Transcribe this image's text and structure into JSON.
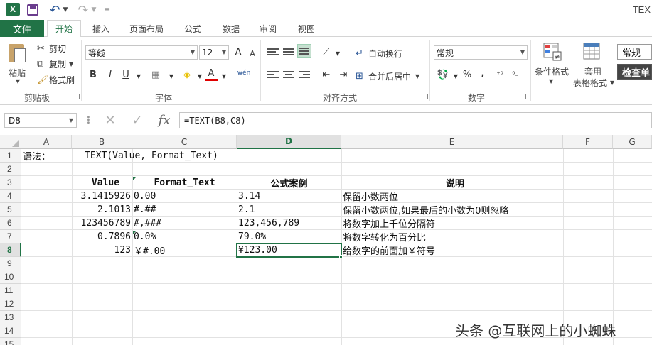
{
  "window": {
    "title": "TEX"
  },
  "quick_access": {
    "logo": "X"
  },
  "tabs": {
    "file": "文件",
    "items": [
      "开始",
      "插入",
      "页面布局",
      "公式",
      "数据",
      "审阅",
      "视图"
    ],
    "active": "开始"
  },
  "ribbon": {
    "clipboard": {
      "paste": "粘贴",
      "cut": "剪切",
      "copy": "复制",
      "format_painter": "格式刷",
      "group": "剪贴板"
    },
    "font": {
      "name": "等线",
      "size": "12",
      "group": "字体",
      "grow": "A",
      "shrink": "A",
      "bold": "B",
      "italic": "I",
      "underline": "U",
      "font_color": "A",
      "phonetic": "wén"
    },
    "alignment": {
      "wrap": "自动换行",
      "merge": "合并后居中",
      "group": "对齐方式"
    },
    "number": {
      "format": "常规",
      "percent": "%",
      "comma": ",",
      "group": "数字"
    },
    "styles": {
      "conditional": "条件格式",
      "table_line1": "套用",
      "table_line2": "表格格式",
      "style_normal": "常规",
      "style_check": "检查单"
    }
  },
  "formula_bar": {
    "name_box": "D8",
    "formula": "=TEXT(B8,C8)",
    "fx": "fx"
  },
  "sheet": {
    "columns": [
      "A",
      "B",
      "C",
      "D",
      "E",
      "F",
      "G"
    ],
    "selected_column": "D",
    "rows": [
      "1",
      "2",
      "3",
      "4",
      "5",
      "6",
      "7",
      "8",
      "9",
      "10",
      "11",
      "12",
      "13",
      "14",
      "15"
    ],
    "selected_row": "8",
    "cells": {
      "A1": "语法：",
      "B1": "TEXT(Value, Format_Text)",
      "B3": "Value",
      "C3": "Format_Text",
      "D3": "公式案例",
      "E3": "说明",
      "B4": "3.1415926",
      "C4": "0.00",
      "D4": "3.14",
      "E4": "保留小数两位",
      "B5": "2.1013",
      "C5": "#.##",
      "D5": "2.1",
      "E5": "保留小数两位,如果最后的小数为0则忽略",
      "B6": "123456789",
      "C6": "#,###",
      "D6": "123,456,789",
      "E6": "将数字加上千位分隔符",
      "B7": "0.7896",
      "C7": "0.0%",
      "D7": "79.0%",
      "E7": "将数字转化为百分比",
      "B8": "123",
      "C8": "￥#.00",
      "D8": "¥123.00",
      "E8": "给数字的前面加￥符号"
    }
  },
  "watermark": "头条 @互联网上的小蜘蛛",
  "colors": {
    "accent": "#217346"
  }
}
